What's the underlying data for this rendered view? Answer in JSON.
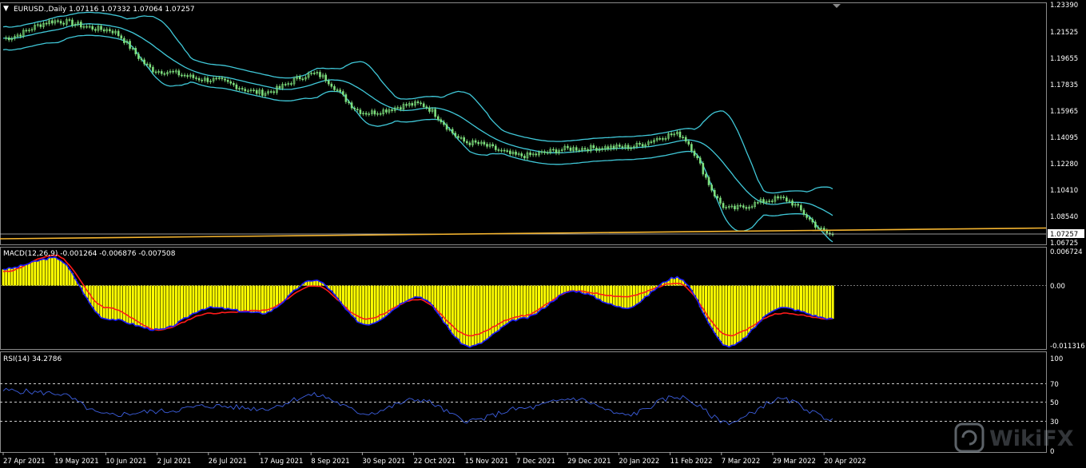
{
  "main_panel": {
    "title": "EURUSD.,Daily  1.07116 1.07332 1.07064 1.07257",
    "price_labels": [
      "1.23390",
      "1.21525",
      "1.19655",
      "1.17835",
      "1.15965",
      "1.14095",
      "1.12280",
      "1.10410",
      "1.08540",
      "1.06725"
    ],
    "current_price": "1.07257"
  },
  "macd_panel": {
    "title": "MACD(12,26,9) -0.001264 -0.006876 -0.007508",
    "labels": [
      "0.006724",
      "0.00",
      "-0.011316"
    ]
  },
  "rsi_panel": {
    "title": "RSI(14) 34.2786",
    "labels": [
      "100",
      "70",
      "50",
      "30",
      "0"
    ]
  },
  "date_labels": [
    "27 Apr 2021",
    "19 May 2021",
    "10 Jun 2021",
    "2 Jul 2021",
    "26 Jul 2021",
    "17 Aug 2021",
    "8 Sep 2021",
    "30 Sep 2021",
    "22 Oct 2021",
    "15 Nov 2021",
    "7 Dec 2021",
    "29 Dec 2021",
    "20 Jan 2022",
    "11 Feb 2022",
    "7 Mar 2022",
    "29 Mar 2022",
    "20 Apr 2022"
  ],
  "watermark": "WikiFX",
  "colors": {
    "price": "#7ee07e",
    "bands": "#40c8d8",
    "hline": "#f5b530",
    "macd_hist": "#ffff00",
    "macd_line": "#1a1aff",
    "signal_line": "#ff1a1a",
    "rsi_line": "#3d5fe0"
  },
  "chart_data": [
    {
      "type": "line",
      "title": "EURUSD.,Daily",
      "x": [
        "27 Apr 2021",
        "19 May 2021",
        "10 Jun 2021",
        "2 Jul 2021",
        "26 Jul 2021",
        "17 Aug 2021",
        "8 Sep 2021",
        "30 Sep 2021",
        "22 Oct 2021",
        "15 Nov 2021",
        "7 Dec 2021",
        "29 Dec 2021",
        "20 Jan 2022",
        "11 Feb 2022",
        "7 Mar 2022",
        "29 Mar 2022",
        "20 Apr 2022"
      ],
      "series": [
        {
          "name": "EURUSD close",
          "values": [
            1.21,
            1.222,
            1.216,
            1.187,
            1.181,
            1.172,
            1.185,
            1.158,
            1.164,
            1.137,
            1.128,
            1.133,
            1.134,
            1.143,
            1.091,
            1.098,
            1.073
          ]
        }
      ],
      "ylim": [
        1.0672,
        1.2339
      ]
    },
    {
      "type": "line",
      "title": "MACD(12,26,9)",
      "x": [
        "27 Apr 2021",
        "19 May 2021",
        "10 Jun 2021",
        "2 Jul 2021",
        "26 Jul 2021",
        "17 Aug 2021",
        "8 Sep 2021",
        "30 Sep 2021",
        "22 Oct 2021",
        "15 Nov 2021",
        "7 Dec 2021",
        "29 Dec 2021",
        "20 Jan 2022",
        "11 Feb 2022",
        "7 Mar 2022",
        "29 Mar 2022",
        "20 Apr 2022"
      ],
      "series": [
        {
          "name": "MACD",
          "values": [
            0.003,
            0.005,
            -0.006,
            -0.008,
            -0.004,
            -0.005,
            0.001,
            -0.007,
            -0.002,
            -0.011,
            -0.006,
            -0.001,
            -0.004,
            0.0015,
            -0.011,
            -0.004,
            -0.006
          ]
        },
        {
          "name": "Signal",
          "values": [
            0.0025,
            0.0055,
            -0.004,
            -0.008,
            -0.005,
            -0.0045,
            0.0,
            -0.006,
            -0.0025,
            -0.009,
            -0.0055,
            -0.001,
            -0.002,
            0.0005,
            -0.009,
            -0.005,
            -0.006
          ]
        }
      ],
      "ylim": [
        -0.011316,
        0.006724
      ]
    },
    {
      "type": "line",
      "title": "RSI(14)",
      "x": [
        "27 Apr 2021",
        "19 May 2021",
        "10 Jun 2021",
        "2 Jul 2021",
        "26 Jul 2021",
        "17 Aug 2021",
        "8 Sep 2021",
        "30 Sep 2021",
        "22 Oct 2021",
        "15 Nov 2021",
        "7 Dec 2021",
        "29 Dec 2021",
        "20 Jan 2022",
        "11 Feb 2022",
        "7 Mar 2022",
        "29 Mar 2022",
        "20 Apr 2022"
      ],
      "series": [
        {
          "name": "RSI(14)",
          "values": [
            65,
            62,
            38,
            42,
            48,
            45,
            60,
            40,
            55,
            32,
            45,
            56,
            38,
            58,
            30,
            55,
            34
          ]
        }
      ],
      "ylim": [
        0,
        100
      ]
    }
  ]
}
